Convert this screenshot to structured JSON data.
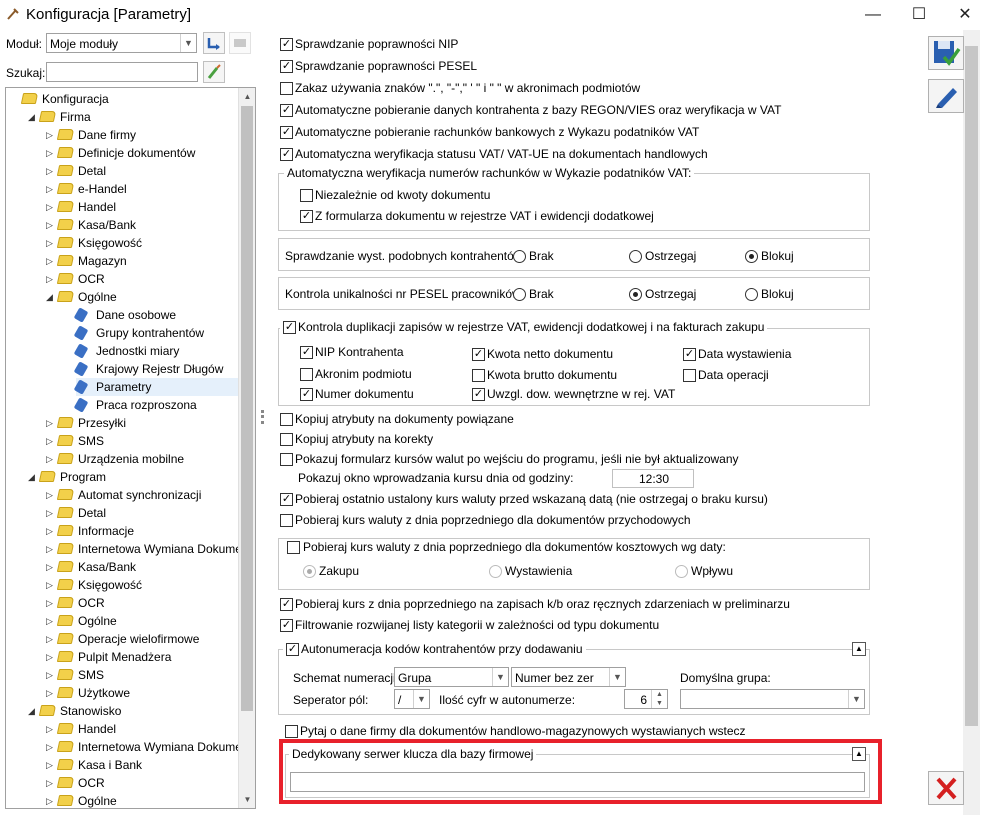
{
  "window": {
    "title": "Konfiguracja [Parametry]",
    "minimize": "—",
    "maximize": "☐",
    "close": "✕"
  },
  "left": {
    "modul_label": "Moduł:",
    "modul_value": "Moje moduły",
    "szukaj_label": "Szukaj:",
    "szukaj_value": "",
    "tree": [
      {
        "label": "Konfiguracja",
        "level": 0,
        "twisty": "",
        "icon": "folder"
      },
      {
        "label": "Firma",
        "level": 1,
        "twisty": "◢",
        "icon": "folder"
      },
      {
        "label": "Dane firmy",
        "level": 2,
        "twisty": "▷",
        "icon": "folder"
      },
      {
        "label": "Definicje dokumentów",
        "level": 2,
        "twisty": "▷",
        "icon": "folder"
      },
      {
        "label": "Detal",
        "level": 2,
        "twisty": "▷",
        "icon": "folder"
      },
      {
        "label": "e-Handel",
        "level": 2,
        "twisty": "▷",
        "icon": "folder"
      },
      {
        "label": "Handel",
        "level": 2,
        "twisty": "▷",
        "icon": "folder"
      },
      {
        "label": "Kasa/Bank",
        "level": 2,
        "twisty": "▷",
        "icon": "folder"
      },
      {
        "label": "Księgowość",
        "level": 2,
        "twisty": "▷",
        "icon": "folder"
      },
      {
        "label": "Magazyn",
        "level": 2,
        "twisty": "▷",
        "icon": "folder"
      },
      {
        "label": "OCR",
        "level": 2,
        "twisty": "▷",
        "icon": "folder"
      },
      {
        "label": "Ogólne",
        "level": 2,
        "twisty": "◢",
        "icon": "folder"
      },
      {
        "label": "Dane osobowe",
        "level": 3,
        "twisty": "",
        "icon": "doc"
      },
      {
        "label": "Grupy kontrahentów",
        "level": 3,
        "twisty": "",
        "icon": "doc"
      },
      {
        "label": "Jednostki miary",
        "level": 3,
        "twisty": "",
        "icon": "doc"
      },
      {
        "label": "Krajowy Rejestr Długów",
        "level": 3,
        "twisty": "",
        "icon": "doc"
      },
      {
        "label": "Parametry",
        "level": 3,
        "twisty": "",
        "icon": "doc",
        "selected": true
      },
      {
        "label": "Praca rozproszona",
        "level": 3,
        "twisty": "",
        "icon": "doc"
      },
      {
        "label": "Przesyłki",
        "level": 2,
        "twisty": "▷",
        "icon": "folder"
      },
      {
        "label": "SMS",
        "level": 2,
        "twisty": "▷",
        "icon": "folder"
      },
      {
        "label": "Urządzenia mobilne",
        "level": 2,
        "twisty": "▷",
        "icon": "folder"
      },
      {
        "label": "Program",
        "level": 1,
        "twisty": "◢",
        "icon": "folder"
      },
      {
        "label": "Automat synchronizacji",
        "level": 2,
        "twisty": "▷",
        "icon": "folder"
      },
      {
        "label": "Detal",
        "level": 2,
        "twisty": "▷",
        "icon": "folder"
      },
      {
        "label": "Informacje",
        "level": 2,
        "twisty": "▷",
        "icon": "folder"
      },
      {
        "label": "Internetowa Wymiana Dokument…",
        "level": 2,
        "twisty": "▷",
        "icon": "folder"
      },
      {
        "label": "Kasa/Bank",
        "level": 2,
        "twisty": "▷",
        "icon": "folder"
      },
      {
        "label": "Księgowość",
        "level": 2,
        "twisty": "▷",
        "icon": "folder"
      },
      {
        "label": "OCR",
        "level": 2,
        "twisty": "▷",
        "icon": "folder"
      },
      {
        "label": "Ogólne",
        "level": 2,
        "twisty": "▷",
        "icon": "folder"
      },
      {
        "label": "Operacje wielofirmowe",
        "level": 2,
        "twisty": "▷",
        "icon": "folder"
      },
      {
        "label": "Pulpit Menadżera",
        "level": 2,
        "twisty": "▷",
        "icon": "folder"
      },
      {
        "label": "SMS",
        "level": 2,
        "twisty": "▷",
        "icon": "folder"
      },
      {
        "label": "Użytkowe",
        "level": 2,
        "twisty": "▷",
        "icon": "folder"
      },
      {
        "label": "Stanowisko",
        "level": 1,
        "twisty": "◢",
        "icon": "folder"
      },
      {
        "label": "Handel",
        "level": 2,
        "twisty": "▷",
        "icon": "folder"
      },
      {
        "label": "Internetowa Wymiana Dokument…",
        "level": 2,
        "twisty": "▷",
        "icon": "folder"
      },
      {
        "label": "Kasa i Bank",
        "level": 2,
        "twisty": "▷",
        "icon": "folder"
      },
      {
        "label": "OCR",
        "level": 2,
        "twisty": "▷",
        "icon": "folder"
      },
      {
        "label": "Ogólne",
        "level": 2,
        "twisty": "▷",
        "icon": "folder"
      }
    ]
  },
  "main": {
    "c_nip": {
      "label": "Sprawdzanie poprawności NIP",
      "checked": true
    },
    "c_pesel": {
      "label": "Sprawdzanie poprawności PESEL",
      "checked": true
    },
    "c_zakaz": {
      "label": "Zakaz używania znaków \".\", \"-\",\" ' \" i \" \" w akronimach podmiotów",
      "checked": false
    },
    "c_regon": {
      "label": "Automatyczne pobieranie danych kontrahenta z bazy REGON/VIES oraz weryfikacja w VAT",
      "checked": true
    },
    "c_rachunki": {
      "label": "Automatyczne pobieranie rachunków bankowych z Wykazu podatników VAT",
      "checked": true
    },
    "c_vatue": {
      "label": "Automatyczna weryfikacja statusu VAT/ VAT-UE na dokumentach handlowych",
      "checked": true
    },
    "grp_weryf": {
      "title": "Automatyczna weryfikacja numerów rachunków w Wykazie podatników VAT:",
      "c_kwota": {
        "label": "Niezależnie od kwoty dokumentu",
        "checked": false
      },
      "c_formularz": {
        "label": "Z formularza dokumentu w rejestrze VAT i ewidencji dodatkowej",
        "checked": true
      }
    },
    "grp_podobni": {
      "label": "Sprawdzanie wyst. podobnych kontrahentów:",
      "opt1": "Brak",
      "opt2": "Ostrzegaj",
      "opt3": "Blokuj",
      "selected": "Blokuj"
    },
    "grp_pesel": {
      "label": "Kontrola unikalności nr PESEL pracowników:",
      "opt1": "Brak",
      "opt2": "Ostrzegaj",
      "opt3": "Blokuj",
      "selected": "Ostrzegaj"
    },
    "grp_dup": {
      "title": "Kontrola duplikacji zapisów w rejestrze VAT, ewidencji dodatkowej i na fakturach zakupu",
      "checked": true,
      "items": [
        {
          "label": "NIP Kontrahenta",
          "checked": true
        },
        {
          "label": "Akronim podmiotu",
          "checked": false
        },
        {
          "label": "Numer dokumentu",
          "checked": true
        },
        {
          "label": "Kwota netto dokumentu",
          "checked": true
        },
        {
          "label": "Kwota brutto dokumentu",
          "checked": false
        },
        {
          "label": "Uwzgl. dow. wewnętrzne w rej. VAT",
          "checked": true
        },
        {
          "label": "Data wystawienia",
          "checked": true
        },
        {
          "label": "Data operacji",
          "checked": false
        }
      ]
    },
    "c_atr_pow": {
      "label": "Kopiuj atrybuty na dokumenty powiązane",
      "checked": false
    },
    "c_atr_kor": {
      "label": "Kopiuj atrybuty na korekty",
      "checked": false
    },
    "c_kursy": {
      "label": "Pokazuj formularz kursów walut po wejściu do programu, jeśli nie był aktualizowany",
      "checked": false
    },
    "kurs_godz": {
      "label": "Pokazuj okno wprowadzania kursu dnia od godziny:",
      "value": "12:30"
    },
    "c_ostatni": {
      "label": "Pobieraj ostatnio ustalony kurs waluty przed wskazaną datą (nie ostrzegaj o braku kursu)",
      "checked": true
    },
    "c_przych": {
      "label": "Pobieraj kurs waluty z dnia poprzedniego dla dokumentów przychodowych",
      "checked": false
    },
    "grp_koszt": {
      "title": "Pobieraj kurs waluty z dnia poprzedniego dla dokumentów kosztowych wg daty:",
      "checked": false,
      "opt1": "Zakupu",
      "opt2": "Wystawienia",
      "opt3": "Wpływu",
      "selected": "Zakupu"
    },
    "c_kb": {
      "label": "Pobieraj kurs z dnia poprzedniego na zapisach k/b oraz ręcznych zdarzeniach w preliminarzu",
      "checked": true
    },
    "c_filtr": {
      "label": "Filtrowanie rozwijanej listy kategorii w zależności od typu dokumentu",
      "checked": true
    },
    "grp_auto": {
      "title": "Autonumeracja kodów kontrahentów przy dodawaniu",
      "checked": true,
      "schemat_label": "Schemat numeracji:",
      "schemat1": "Grupa",
      "schemat2": "Numer bez zer",
      "grupa_label": "Domyślna grupa:",
      "grupa_value": "",
      "sep_label": "Seperator pól:",
      "sep_value": "/",
      "cyfr_label": "Ilość cyfr w autonumerze:",
      "cyfr_value": "6"
    },
    "c_pytaj": {
      "label": "Pytaj o dane firmy dla dokumentów handlowo-magazynowych wystawianych wstecz",
      "checked": false
    },
    "grp_serwer": {
      "title": "Dedykowany serwer klucza dla bazy firmowej",
      "value": ""
    }
  },
  "colors": {
    "highlight": "#e8212b",
    "folder": "#f2d04a",
    "selection": "#e5f0fb"
  }
}
